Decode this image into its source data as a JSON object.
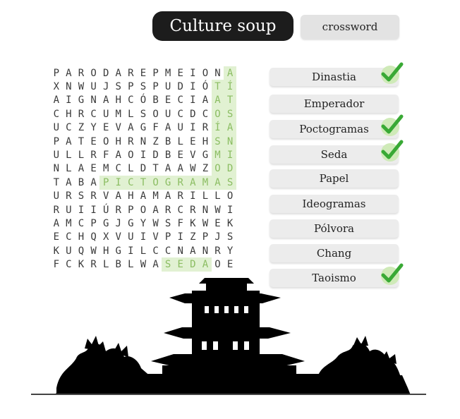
{
  "header": {
    "title": "Culture soup",
    "crossword_label": "crossword"
  },
  "grid": [
    "PARODAREPMEIONA",
    "XNWUJSPSPUDIÓTÍ",
    "AIGNAHCÓBECIAAT",
    "CHRCUMLSOUCDCOS",
    "UCZYEVAGFAUIRÍA",
    "PATEOHRNZBLEHSN",
    "ULLRFAOIDBEVGMI",
    "NLAEMCLDTAAWZOD",
    "TABAPICTOGRAMAS",
    "URSRVAHAMARILLO",
    "RUIIÚRPOARCRNWI",
    "AMCPGJGYWSFKWEK",
    "ECHQXVUIVPIZPJS",
    "KUQWHGILCCNANRY",
    "FCKRLBLWASEDAOE"
  ],
  "found_words": [
    {
      "word": "PICTOGRAMAS",
      "cells": [
        [
          8,
          4
        ],
        [
          8,
          5
        ],
        [
          8,
          6
        ],
        [
          8,
          7
        ],
        [
          8,
          8
        ],
        [
          8,
          9
        ],
        [
          8,
          10
        ],
        [
          8,
          11
        ],
        [
          8,
          12
        ],
        [
          8,
          13
        ],
        [
          8,
          14
        ]
      ]
    },
    {
      "word": "SEDA",
      "cells": [
        [
          14,
          9
        ],
        [
          14,
          10
        ],
        [
          14,
          11
        ],
        [
          14,
          12
        ]
      ]
    },
    {
      "word": "TAOISMO",
      "cells": [
        [
          1,
          13
        ],
        [
          2,
          13
        ],
        [
          3,
          13
        ],
        [
          4,
          13
        ],
        [
          5,
          13
        ],
        [
          6,
          13
        ],
        [
          7,
          13
        ]
      ]
    },
    {
      "word": "DINASTIA",
      "cells": [
        [
          7,
          14
        ],
        [
          6,
          14
        ],
        [
          5,
          14
        ],
        [
          4,
          14
        ],
        [
          3,
          14
        ],
        [
          2,
          14
        ],
        [
          1,
          14
        ],
        [
          0,
          14
        ]
      ]
    }
  ],
  "word_list": [
    {
      "label": "Dinastia",
      "found": true
    },
    {
      "label": "Emperador",
      "found": false
    },
    {
      "label": "Poctogramas",
      "found": true
    },
    {
      "label": "Seda",
      "found": true
    },
    {
      "label": "Papel",
      "found": false
    },
    {
      "label": "Ideogramas",
      "found": false
    },
    {
      "label": "Pólvora",
      "found": false
    },
    {
      "label": "Chang",
      "found": false
    },
    {
      "label": "Taoismo",
      "found": true
    }
  ],
  "colors": {
    "highlight_bg": "#e1f1d2",
    "highlight_text": "#8bbd62",
    "check": "#39a935",
    "title_bg": "#1c1c1c"
  }
}
